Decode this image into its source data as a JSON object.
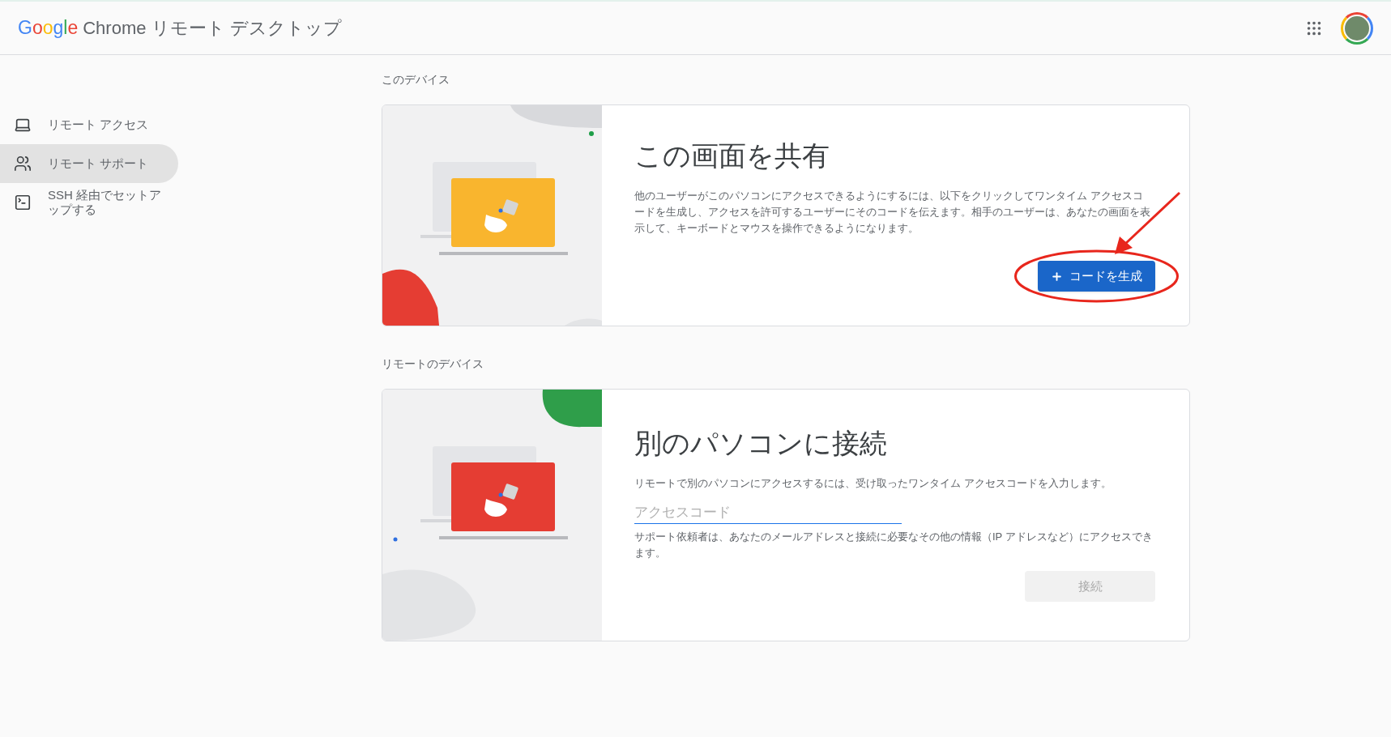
{
  "header": {
    "logo": "Google",
    "title": "Chrome リモート デスクトップ"
  },
  "sidebar": {
    "items": [
      {
        "label": "リモート アクセス",
        "selected": false
      },
      {
        "label": "リモート サポート",
        "selected": true
      },
      {
        "label": "SSH 経由でセットアップする",
        "selected": false
      }
    ]
  },
  "sections": [
    {
      "heading": "このデバイス",
      "card": {
        "title": "この画面を共有",
        "description": "他のユーザーがこのパソコンにアクセスできるようにするには、以下をクリックしてワンタイム アクセスコードを生成し、アクセスを許可するユーザーにそのコードを伝えます。相手のユーザーは、あなたの画面を表示して、キーボードとマウスを操作できるようになります。",
        "button": {
          "label": "コードを生成",
          "disabled": false
        }
      }
    },
    {
      "heading": "リモートのデバイス",
      "card": {
        "title": "別のパソコンに接続",
        "description": "リモートで別のパソコンにアクセスするには、受け取ったワンタイム アクセスコードを入力します。",
        "field": {
          "placeholder": "アクセスコード"
        },
        "note": "サポート依頼者は、あなたのメールアドレスと接続に必要なその他の情報（IP アドレスなど）にアクセスできます。",
        "button": {
          "label": "接続",
          "disabled": true
        }
      }
    }
  ]
}
